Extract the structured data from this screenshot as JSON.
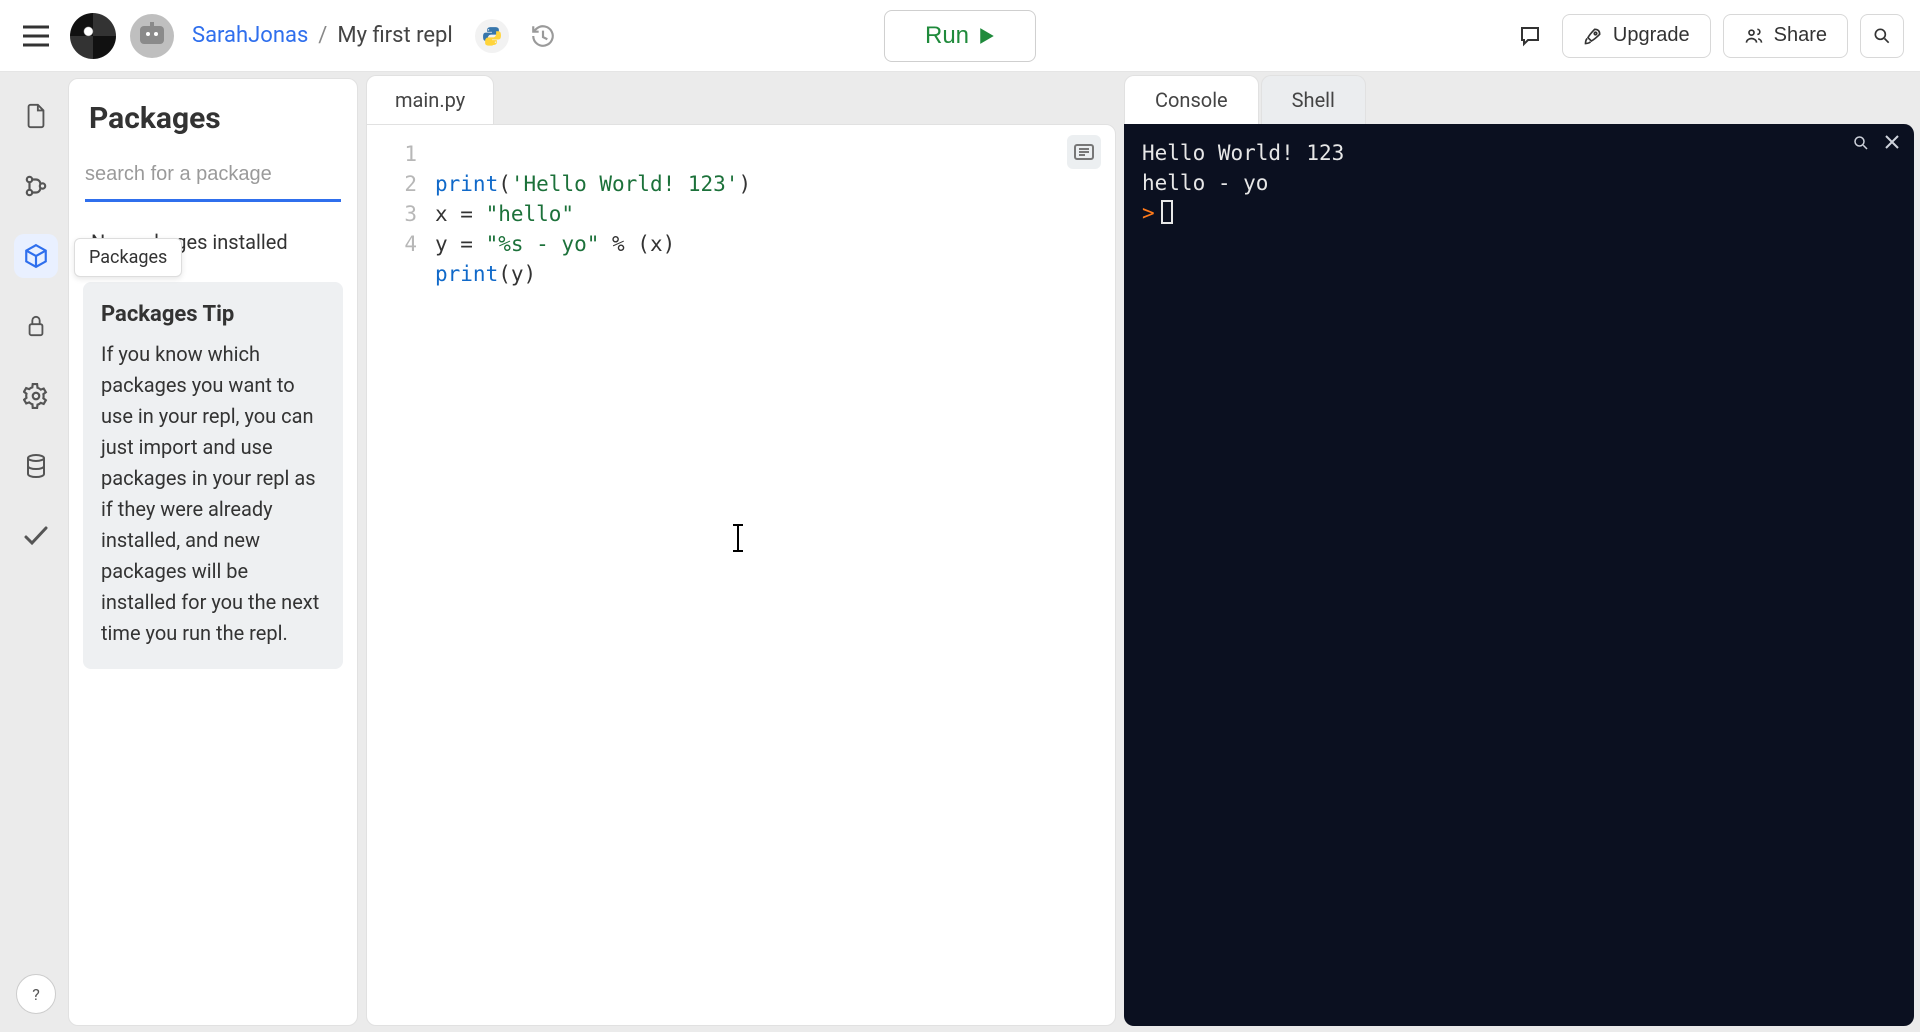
{
  "header": {
    "username": "SarahJonas",
    "repl_name": "My first repl",
    "run_label": "Run",
    "upgrade_label": "Upgrade",
    "share_label": "Share"
  },
  "sidebar_rail": {
    "items": [
      {
        "name": "files-icon"
      },
      {
        "name": "version-control-icon"
      },
      {
        "name": "packages-icon",
        "active": true,
        "tooltip": "Packages"
      },
      {
        "name": "secrets-icon"
      },
      {
        "name": "settings-icon"
      },
      {
        "name": "database-icon"
      },
      {
        "name": "checkmark-icon"
      }
    ],
    "help_label": "?"
  },
  "packages_panel": {
    "title": "Packages",
    "search_placeholder": "search for a package",
    "empty_text": "No packages installed",
    "tip_title": "Packages Tip",
    "tip_body": "If you know which packages you want to use in your repl, you can just import and use packages in your repl as if they were already installed, and new packages will be installed for you the next time you run the repl."
  },
  "editor": {
    "tab_label": "main.py",
    "lines": [
      {
        "n": "1",
        "fn": "print",
        "rest_open": "(",
        "str": "'Hello World! 123'",
        "rest_close": ")"
      },
      {
        "n": "2",
        "plain_a": "x = ",
        "str": "\"hello\""
      },
      {
        "n": "3",
        "plain_a": "y = ",
        "str": "\"%s - yo\"",
        "plain_b": " % (x)"
      },
      {
        "n": "4",
        "fn": "print",
        "rest_open": "(y)",
        "str": "",
        "rest_close": ""
      }
    ]
  },
  "console": {
    "tabs": {
      "console": "Console",
      "shell": "Shell"
    },
    "output": [
      "Hello World! 123",
      "hello - yo"
    ],
    "prompt": ">"
  }
}
